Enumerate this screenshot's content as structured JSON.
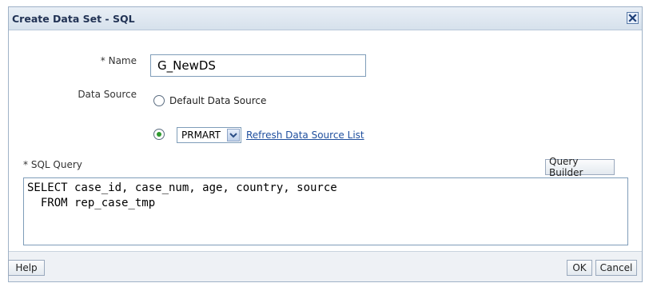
{
  "dialog": {
    "title": "Create Data Set - SQL",
    "close_icon": "close-icon"
  },
  "form": {
    "name_required_marker": "*",
    "name_label": "Name",
    "name_value": "G_NewDS",
    "datasource_label": "Data Source",
    "radio_default_label": "Default Data Source",
    "radio_default_checked": false,
    "radio_custom_checked": true,
    "datasource_selected": "PRMART",
    "refresh_link": "Refresh Data Source List",
    "sql_required_marker": "*",
    "sql_label": "SQL Query",
    "query_builder_label": "Query Builder",
    "sql_text": "SELECT case_id, case_num, age, country, source\n  FROM rep_case_tmp"
  },
  "footer": {
    "help_label": "Help",
    "ok_label": "OK",
    "cancel_label": "Cancel"
  },
  "colors": {
    "titlebar": "#d6e1ec",
    "link": "#1f4f9e",
    "radio_selected": "#2f9a2f"
  }
}
